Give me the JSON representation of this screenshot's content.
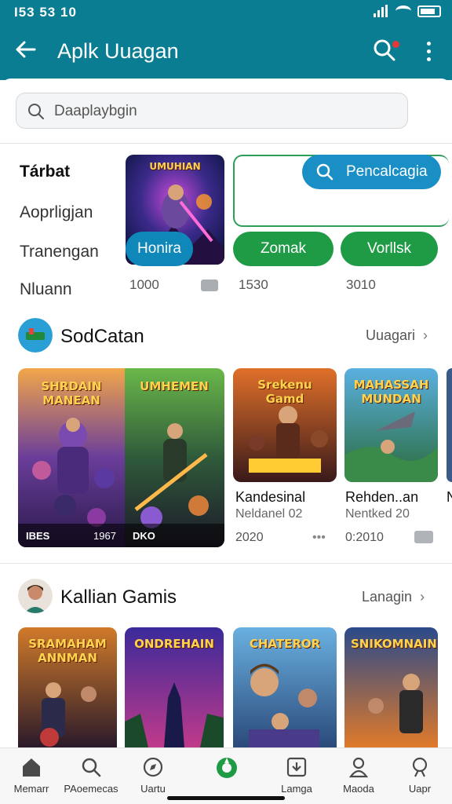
{
  "status": {
    "time": "I53 53 10"
  },
  "appbar": {
    "title": "Aplk Uuagan"
  },
  "search": {
    "placeholder": "Daaplaybgin"
  },
  "categories": [
    {
      "label": "Tárbat",
      "active": true
    },
    {
      "label": "Aoprligjan",
      "active": false
    },
    {
      "label": "Tranengan",
      "active": false
    },
    {
      "label": "Nluann",
      "active": false
    }
  ],
  "featured": {
    "card_title": "UMUHIAN",
    "search_pill": "Pencalcagia",
    "buttons": [
      "Honira",
      "Zomak",
      "Vorllsk"
    ],
    "counts": [
      "1000",
      "1530",
      "3010"
    ]
  },
  "section1": {
    "title": "SodCatan",
    "link": "Uuagari",
    "big_card": {
      "left_title": "SHRDAIN MANEAN",
      "right_title": "UMHEMEN",
      "footer_left": "IBES",
      "footer_mid": "1967",
      "footer_right": "DKO"
    },
    "games": [
      {
        "art_title": "Srekenu Gamd",
        "name": "Kandesinal",
        "sub": "Neldanel 02",
        "num": "2020"
      },
      {
        "art_title": "MAHASSAH MUNDAN",
        "name": "Rehden..an",
        "sub": "Nentked 20",
        "num": "0:2010"
      },
      {
        "art_title": "",
        "name": "N",
        "sub": "",
        "num": ""
      }
    ]
  },
  "section2": {
    "title": "Kallian Gamis",
    "link": "Lanagin",
    "games": [
      {
        "art_title": "SRAMAHAM ANNMAN"
      },
      {
        "art_title": "ONDREHAIN"
      },
      {
        "art_title": "CHATEROR"
      },
      {
        "art_title": "SNIKOMNAIN"
      }
    ]
  },
  "nav": [
    {
      "label": "Memarr",
      "icon": "home-icon"
    },
    {
      "label": "PAoemecas",
      "icon": "search-icon"
    },
    {
      "label": "Uartu",
      "icon": "compass-icon"
    },
    {
      "label": "",
      "icon": "brand-icon"
    },
    {
      "label": "Lamga",
      "icon": "download-icon"
    },
    {
      "label": "Maoda",
      "icon": "person-icon"
    },
    {
      "label": "Uapr",
      "icon": "profile-icon"
    }
  ],
  "colors": {
    "primary": "#0a7d92",
    "green": "#1f9a45",
    "blue": "#0b73b0"
  }
}
